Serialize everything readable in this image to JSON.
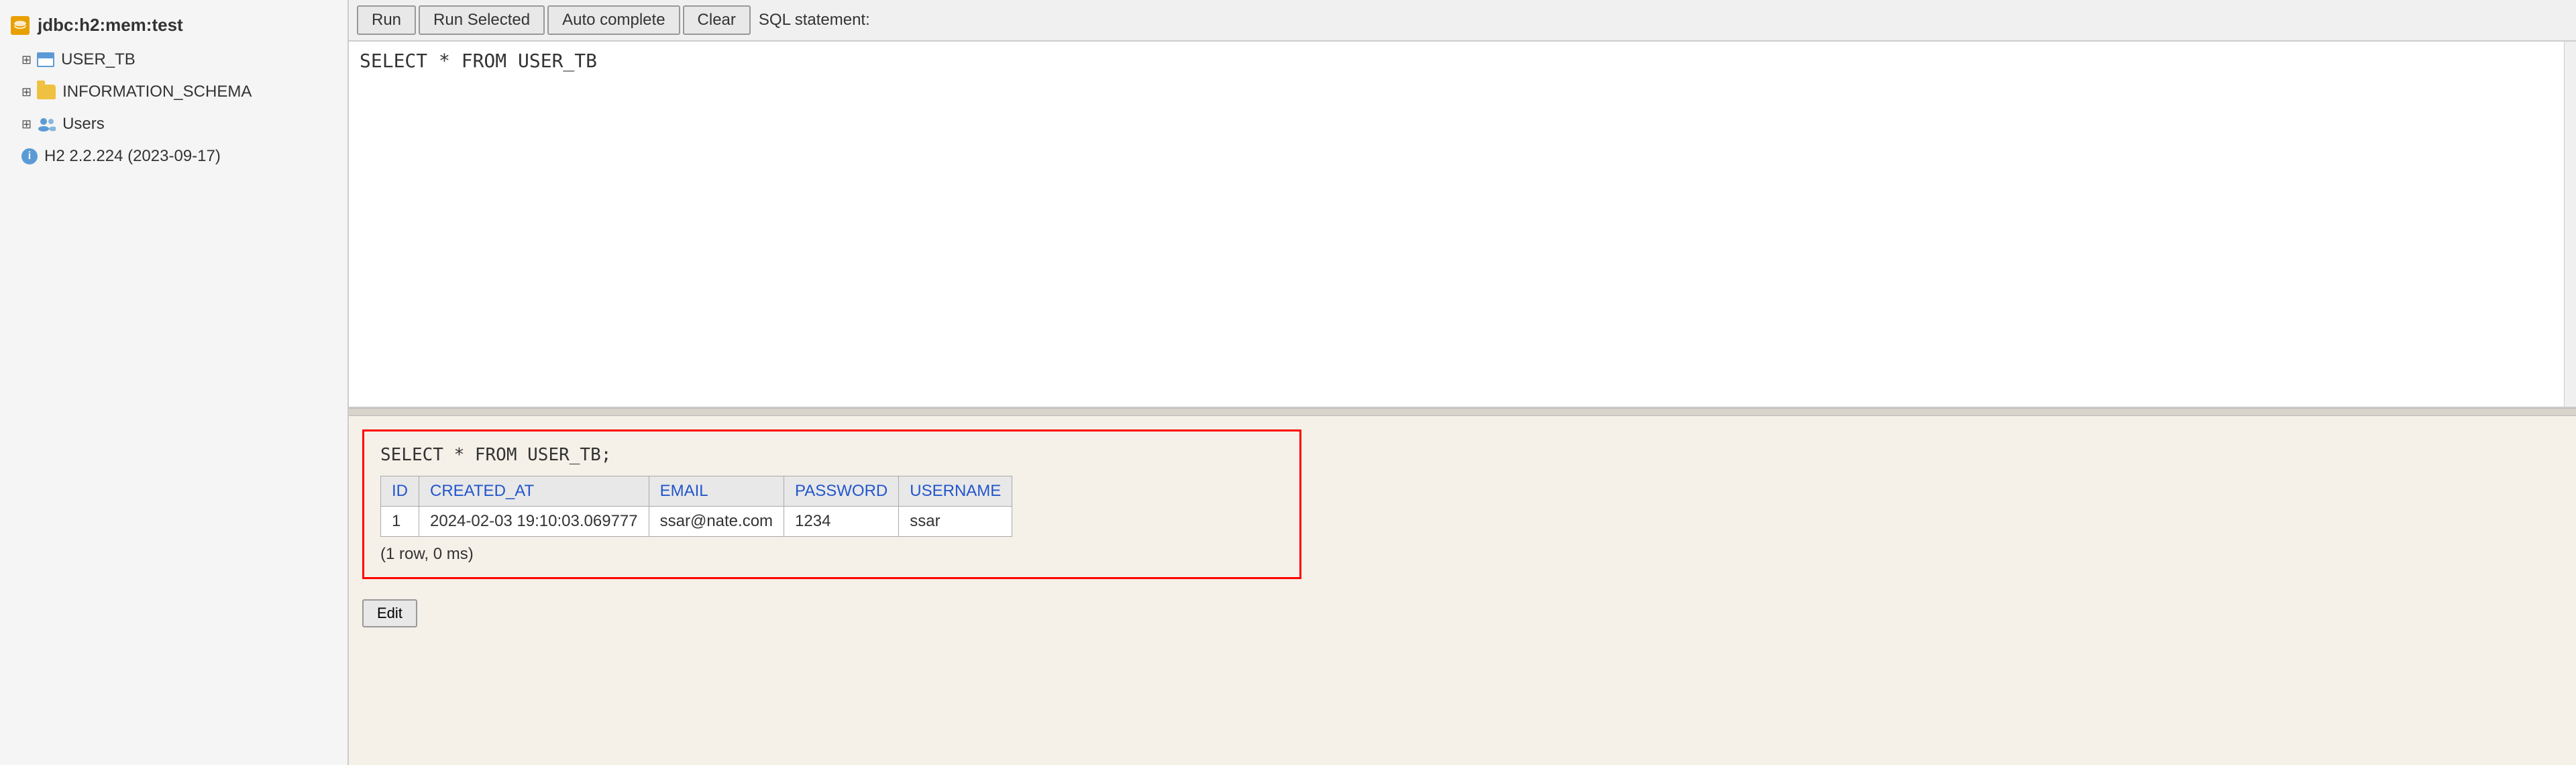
{
  "sidebar": {
    "connection": {
      "label": "jdbc:h2:mem:test",
      "icon": "database-icon"
    },
    "items": [
      {
        "id": "user-tb",
        "label": "USER_TB",
        "icon": "table-icon",
        "expandable": true
      },
      {
        "id": "information-schema",
        "label": "INFORMATION_SCHEMA",
        "icon": "folder-icon",
        "expandable": true
      },
      {
        "id": "users",
        "label": "Users",
        "icon": "users-icon",
        "expandable": true
      },
      {
        "id": "h2-version",
        "label": "H2 2.2.224 (2023-09-17)",
        "icon": "info-icon",
        "expandable": false
      }
    ]
  },
  "toolbar": {
    "run_label": "Run",
    "run_selected_label": "Run Selected",
    "auto_complete_label": "Auto complete",
    "clear_label": "Clear",
    "sql_statement_label": "SQL statement:"
  },
  "editor": {
    "sql_content": "SELECT * FROM USER_TB"
  },
  "results": {
    "query": "SELECT * FROM USER_TB;",
    "columns": [
      "ID",
      "CREATED_AT",
      "EMAIL",
      "PASSWORD",
      "USERNAME"
    ],
    "rows": [
      {
        "id": "1",
        "created_at": "2024-02-03 19:10:03.069777",
        "email": "ssar@nate.com",
        "password": "1234",
        "username": "ssar"
      }
    ],
    "summary": "(1 row, 0 ms)"
  },
  "bottom": {
    "edit_label": "Edit"
  }
}
